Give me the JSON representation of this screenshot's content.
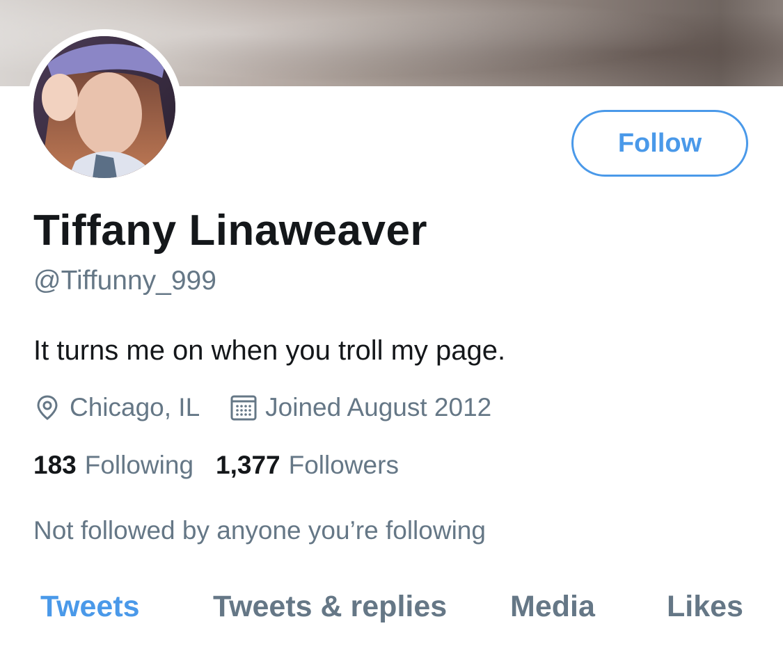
{
  "profile": {
    "display_name": "Tiffany Linaweaver",
    "handle": "@Tiffunny_999",
    "bio": "It turns me on when you troll my page.",
    "location": "Chicago, IL",
    "joined": "Joined August 2012",
    "following_count": "183",
    "following_label": "Following",
    "followers_count": "1,377",
    "followers_label": "Followers",
    "mutuals_note": "Not followed by anyone you’re following"
  },
  "actions": {
    "follow_label": "Follow"
  },
  "tabs": [
    {
      "label": "Tweets",
      "active": true
    },
    {
      "label": "Tweets & replies",
      "active": false
    },
    {
      "label": "Media",
      "active": false
    },
    {
      "label": "Likes",
      "active": false
    }
  ],
  "icons": {
    "location": "location-pin-icon",
    "calendar": "calendar-icon"
  },
  "colors": {
    "accent": "#4a99e9",
    "primary_text": "#14171a",
    "secondary_text": "#657786",
    "background": "#ffffff"
  }
}
